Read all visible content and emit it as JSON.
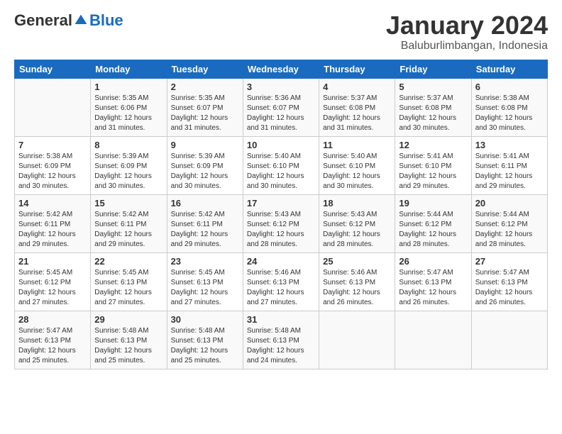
{
  "logo": {
    "general": "General",
    "blue": "Blue"
  },
  "title": "January 2024",
  "subtitle": "Baluburlimbangan, Indonesia",
  "header_days": [
    "Sunday",
    "Monday",
    "Tuesday",
    "Wednesday",
    "Thursday",
    "Friday",
    "Saturday"
  ],
  "weeks": [
    [
      {
        "day": "",
        "info": ""
      },
      {
        "day": "1",
        "info": "Sunrise: 5:35 AM\nSunset: 6:06 PM\nDaylight: 12 hours\nand 31 minutes."
      },
      {
        "day": "2",
        "info": "Sunrise: 5:35 AM\nSunset: 6:07 PM\nDaylight: 12 hours\nand 31 minutes."
      },
      {
        "day": "3",
        "info": "Sunrise: 5:36 AM\nSunset: 6:07 PM\nDaylight: 12 hours\nand 31 minutes."
      },
      {
        "day": "4",
        "info": "Sunrise: 5:37 AM\nSunset: 6:08 PM\nDaylight: 12 hours\nand 31 minutes."
      },
      {
        "day": "5",
        "info": "Sunrise: 5:37 AM\nSunset: 6:08 PM\nDaylight: 12 hours\nand 30 minutes."
      },
      {
        "day": "6",
        "info": "Sunrise: 5:38 AM\nSunset: 6:08 PM\nDaylight: 12 hours\nand 30 minutes."
      }
    ],
    [
      {
        "day": "7",
        "info": "Sunrise: 5:38 AM\nSunset: 6:09 PM\nDaylight: 12 hours\nand 30 minutes."
      },
      {
        "day": "8",
        "info": "Sunrise: 5:39 AM\nSunset: 6:09 PM\nDaylight: 12 hours\nand 30 minutes."
      },
      {
        "day": "9",
        "info": "Sunrise: 5:39 AM\nSunset: 6:09 PM\nDaylight: 12 hours\nand 30 minutes."
      },
      {
        "day": "10",
        "info": "Sunrise: 5:40 AM\nSunset: 6:10 PM\nDaylight: 12 hours\nand 30 minutes."
      },
      {
        "day": "11",
        "info": "Sunrise: 5:40 AM\nSunset: 6:10 PM\nDaylight: 12 hours\nand 30 minutes."
      },
      {
        "day": "12",
        "info": "Sunrise: 5:41 AM\nSunset: 6:10 PM\nDaylight: 12 hours\nand 29 minutes."
      },
      {
        "day": "13",
        "info": "Sunrise: 5:41 AM\nSunset: 6:11 PM\nDaylight: 12 hours\nand 29 minutes."
      }
    ],
    [
      {
        "day": "14",
        "info": "Sunrise: 5:42 AM\nSunset: 6:11 PM\nDaylight: 12 hours\nand 29 minutes."
      },
      {
        "day": "15",
        "info": "Sunrise: 5:42 AM\nSunset: 6:11 PM\nDaylight: 12 hours\nand 29 minutes."
      },
      {
        "day": "16",
        "info": "Sunrise: 5:42 AM\nSunset: 6:11 PM\nDaylight: 12 hours\nand 29 minutes."
      },
      {
        "day": "17",
        "info": "Sunrise: 5:43 AM\nSunset: 6:12 PM\nDaylight: 12 hours\nand 28 minutes."
      },
      {
        "day": "18",
        "info": "Sunrise: 5:43 AM\nSunset: 6:12 PM\nDaylight: 12 hours\nand 28 minutes."
      },
      {
        "day": "19",
        "info": "Sunrise: 5:44 AM\nSunset: 6:12 PM\nDaylight: 12 hours\nand 28 minutes."
      },
      {
        "day": "20",
        "info": "Sunrise: 5:44 AM\nSunset: 6:12 PM\nDaylight: 12 hours\nand 28 minutes."
      }
    ],
    [
      {
        "day": "21",
        "info": "Sunrise: 5:45 AM\nSunset: 6:12 PM\nDaylight: 12 hours\nand 27 minutes."
      },
      {
        "day": "22",
        "info": "Sunrise: 5:45 AM\nSunset: 6:13 PM\nDaylight: 12 hours\nand 27 minutes."
      },
      {
        "day": "23",
        "info": "Sunrise: 5:45 AM\nSunset: 6:13 PM\nDaylight: 12 hours\nand 27 minutes."
      },
      {
        "day": "24",
        "info": "Sunrise: 5:46 AM\nSunset: 6:13 PM\nDaylight: 12 hours\nand 27 minutes."
      },
      {
        "day": "25",
        "info": "Sunrise: 5:46 AM\nSunset: 6:13 PM\nDaylight: 12 hours\nand 26 minutes."
      },
      {
        "day": "26",
        "info": "Sunrise: 5:47 AM\nSunset: 6:13 PM\nDaylight: 12 hours\nand 26 minutes."
      },
      {
        "day": "27",
        "info": "Sunrise: 5:47 AM\nSunset: 6:13 PM\nDaylight: 12 hours\nand 26 minutes."
      }
    ],
    [
      {
        "day": "28",
        "info": "Sunrise: 5:47 AM\nSunset: 6:13 PM\nDaylight: 12 hours\nand 25 minutes."
      },
      {
        "day": "29",
        "info": "Sunrise: 5:48 AM\nSunset: 6:13 PM\nDaylight: 12 hours\nand 25 minutes."
      },
      {
        "day": "30",
        "info": "Sunrise: 5:48 AM\nSunset: 6:13 PM\nDaylight: 12 hours\nand 25 minutes."
      },
      {
        "day": "31",
        "info": "Sunrise: 5:48 AM\nSunset: 6:13 PM\nDaylight: 12 hours\nand 24 minutes."
      },
      {
        "day": "",
        "info": ""
      },
      {
        "day": "",
        "info": ""
      },
      {
        "day": "",
        "info": ""
      }
    ]
  ]
}
